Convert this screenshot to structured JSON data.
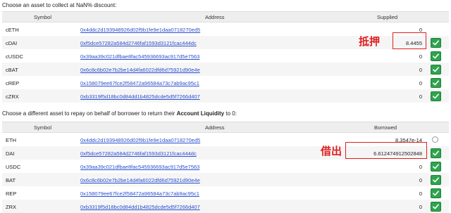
{
  "collect_prompt": "Choose an asset to collect at NaN% discount:",
  "collect_table": {
    "headers": {
      "symbol": "Symbol",
      "address": "Address",
      "amount": "Supplied"
    },
    "rows": [
      {
        "symbol": "cETH",
        "address": "0x4ddc2d193948926d02f9b1fe9e1daa0718270ed5",
        "value": "0",
        "selected": false
      },
      {
        "symbol": "cDAI",
        "address": "0xf5dce57282a584d2746faf1593d3121fcac444dc",
        "value": "8.4455",
        "selected": true
      },
      {
        "symbol": "cUSDC",
        "address": "0x39aa39c021dfbae8fac545936693ac917d5e7563",
        "value": "0",
        "selected": true
      },
      {
        "symbol": "cBAT",
        "address": "0x6c8c6b02e7b2be14d4fa6022dfd6d75921d90e4e",
        "value": "0",
        "selected": true
      },
      {
        "symbol": "cREP",
        "address": "0x158079ee67fce2f58472a96584a73c7ab9ac95c1",
        "value": "0",
        "selected": true
      },
      {
        "symbol": "cZRX",
        "address": "0xb3319f5d18bc0d84dd1b4825dcde5d5f7266d407",
        "value": "0",
        "selected": true
      }
    ]
  },
  "repay_prompt_start": "Choose a different asset to repay on behalf of borrower to return their ",
  "repay_prompt_bold": "Account Liquidity",
  "repay_prompt_end": " to 0:",
  "repay_table": {
    "headers": {
      "symbol": "Symbol",
      "address": "Address",
      "amount": "Borrowed"
    },
    "rows": [
      {
        "symbol": "ETH",
        "address": "0x4ddc2d193948926d02f9b1fe9e1daa0718270ed5",
        "value": "8.3547e-14",
        "control": "radio"
      },
      {
        "symbol": "DAI",
        "address": "0xf5dce57282a584d2746faf1593d3121fcac444dc",
        "value": "6.612474912502848",
        "control": "check"
      },
      {
        "symbol": "USDC",
        "address": "0x39aa39c021dfbae8fac545936693ac917d5e7563",
        "value": "0",
        "control": "check"
      },
      {
        "symbol": "BAT",
        "address": "0x6c8c6b02e7b2be14d4fa6022dfd6d75921d90e4e",
        "value": "0",
        "control": "check"
      },
      {
        "symbol": "REP",
        "address": "0x158079ee67fce2f58472a96584a73c7ab9ac95c1",
        "value": "0",
        "control": "check"
      },
      {
        "symbol": "ZRX",
        "address": "0xb3319f5d18bc0d84dd1b4825dcde5d5f7266d407",
        "value": "0",
        "control": "check"
      }
    ]
  },
  "annotations": {
    "collateral_label": "抵押",
    "borrow_label": "借出",
    "color": "#e02020"
  },
  "colors": {
    "check_green": "#2ea44f",
    "link_blue": "#2a4fcf",
    "header_gray": "#eeeeee"
  }
}
